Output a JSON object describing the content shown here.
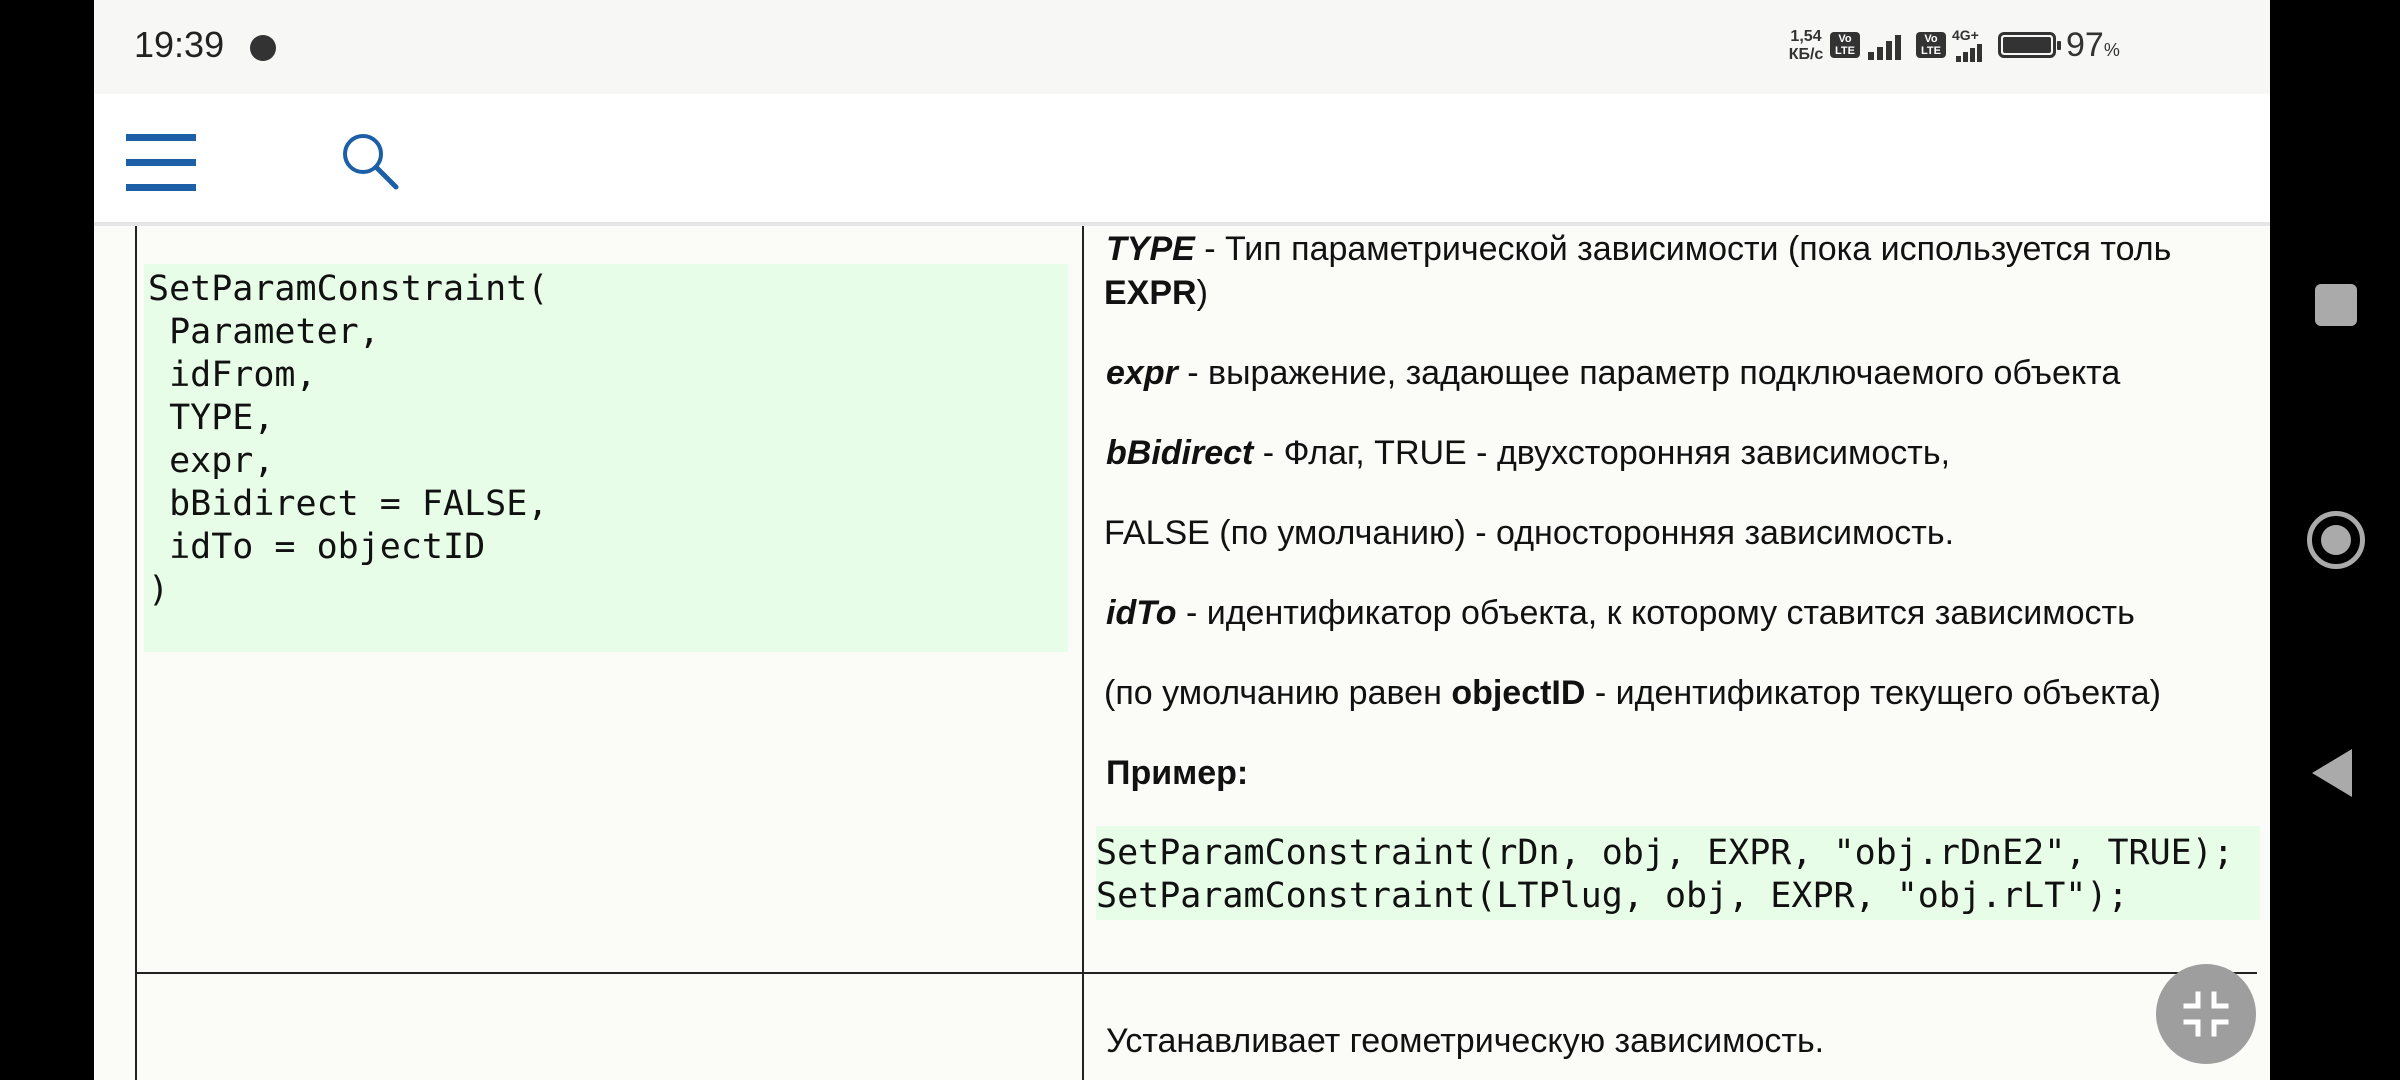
{
  "status_bar": {
    "time": "19:39",
    "net_speed_value": "1,54",
    "net_speed_unit": "КБ/с",
    "volte_label": "Vo LTE",
    "network_type": "4G+",
    "battery_percent": "97",
    "battery_unit": "%"
  },
  "app_bar": {
    "menu_icon": "hamburger-menu-icon",
    "search_icon": "search-icon",
    "accent_color": "#1d5fa6"
  },
  "table": {
    "left_code_lines": [
      "SetParamConstraint(",
      " Parameter,",
      " idFrom,",
      " TYPE,",
      " expr,",
      " bBidirect = FALSE,",
      " idTo = objectID",
      ")"
    ],
    "desc": {
      "type_param": "TYPE",
      "type_text": " - Тип параметрической зависимости (пока используется толь",
      "type_value": "EXPR",
      "type_close": ")",
      "expr_param": "expr",
      "expr_text": " - выражение, задающее параметр подключаемого объекта",
      "bbidirect_param": "bBidirect",
      "bbidirect_text": " - Флаг, TRUE - двухсторонняя зависимость,",
      "false_text": "FALSE (по умолчанию) - односторонняя зависимость.",
      "idto_param": "idTo",
      "idto_text": " - идентификатор объекта, к которому ставится зависимость",
      "default_prefix": "(по умолчанию равен ",
      "default_value": "objectID",
      "default_suffix": " - идентификатор текущего объекта)",
      "example_label": "Пример:"
    },
    "example_code_lines": [
      "SetParamConstraint(rDn, obj, EXPR, \"obj.rDnE2\", TRUE);",
      "SetParamConstraint(LTPlug, obj, EXPR, \"obj.rLT\");"
    ],
    "next_row_text": "Устанавливает геометрическую зависимость."
  },
  "fab": {
    "icon": "collapse-fullscreen-icon"
  },
  "nav_bar": {
    "recents_icon": "recents-square-icon",
    "home_icon": "home-circle-icon",
    "back_icon": "back-triangle-icon"
  }
}
